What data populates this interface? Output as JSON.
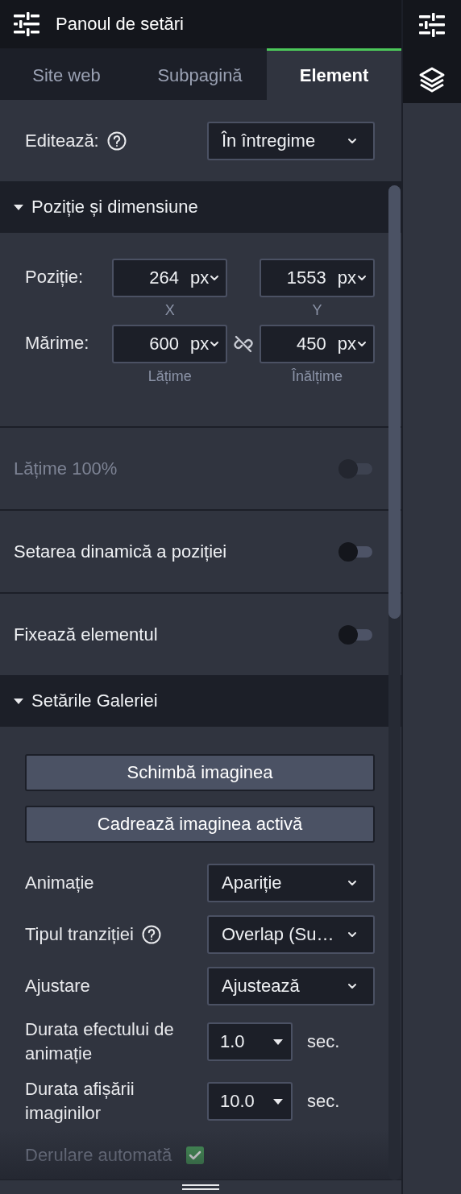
{
  "header": {
    "title": "Panoul de setări"
  },
  "tabs": [
    {
      "label": "Site web",
      "selected": false
    },
    {
      "label": "Subpagină",
      "selected": false
    },
    {
      "label": "Element",
      "selected": true
    }
  ],
  "edit": {
    "label": "Editează:",
    "help": true,
    "value": "În întregime"
  },
  "position_section": {
    "title": "Poziție și dimensiune",
    "expanded": true,
    "rows": [
      {
        "label": "Poziție:",
        "aspect_locked": null,
        "fields": [
          {
            "value": "264",
            "unit": "px",
            "caption": "X"
          },
          {
            "value": "1553",
            "unit": "px",
            "caption": "Y"
          }
        ]
      },
      {
        "label": "Mărime:",
        "aspect_locked": false,
        "fields": [
          {
            "value": "600",
            "unit": "px",
            "caption": "Lățime"
          },
          {
            "value": "450",
            "unit": "px",
            "caption": "Înălțime"
          }
        ]
      }
    ]
  },
  "toggles": [
    {
      "label": "Lățime 100%",
      "on": false,
      "disabled": true
    },
    {
      "label": "Setarea dinamică a poziției",
      "on": false,
      "disabled": false
    },
    {
      "label": "Fixează elementul",
      "on": false,
      "disabled": false
    }
  ],
  "gallery_section": {
    "title": "Setările Galeriei",
    "expanded": true,
    "buttons": [
      "Schimbă imaginea",
      "Cadrează imaginea activă"
    ],
    "settings": [
      {
        "kind": "select",
        "label": "Animație",
        "help": false,
        "value": "Apariție"
      },
      {
        "kind": "select",
        "label": "Tipul tranziției",
        "help": true,
        "value": "Overlap (Su…"
      },
      {
        "kind": "select",
        "label": "Ajustare",
        "help": false,
        "value": "Ajustează"
      },
      {
        "kind": "number",
        "label": "Durata efectului de animație",
        "value": "1.0",
        "unit": "sec."
      },
      {
        "kind": "number",
        "label": "Durata afișării imaginilor",
        "value": "10.0",
        "unit": "sec."
      },
      {
        "kind": "checkbox",
        "label": "Derulare automată",
        "checked": true,
        "disabled": true
      }
    ]
  }
}
